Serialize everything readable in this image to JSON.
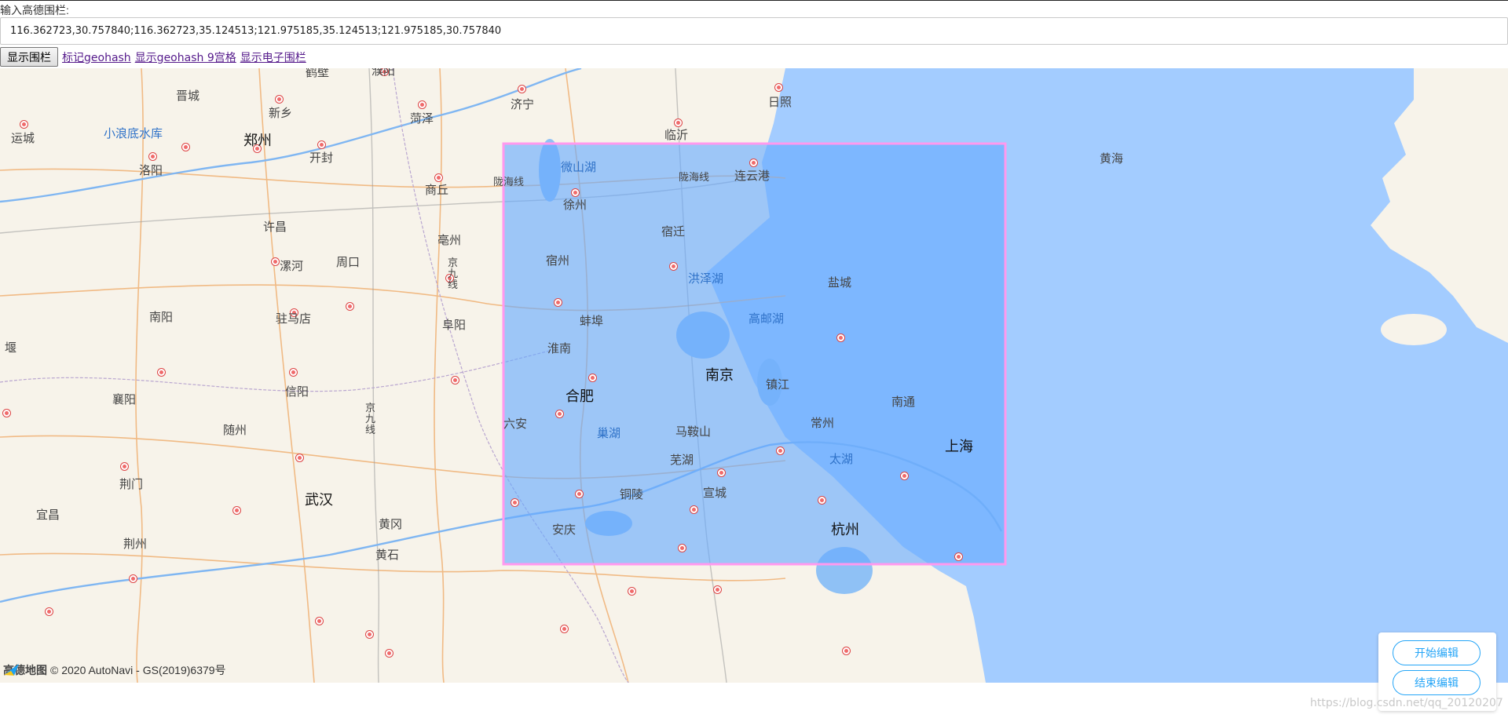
{
  "form": {
    "label": "输入高德围栏:",
    "fence_value": "116.362723,30.757840;116.362723,35.124513;121.975185,35.124513;121.975185,30.757840",
    "show_button": "显示围栏",
    "links": [
      "标记geohash",
      "显示geohash 9宫格",
      "显示电子围栏"
    ]
  },
  "map": {
    "labels": {
      "hebi": "鹤壁",
      "puyang": "濮阳",
      "jincheng": "晋城",
      "xinxiang": "新乡",
      "heze": "菏泽",
      "jining": "济宁",
      "rizhao": "日照",
      "yuncheng": "运城",
      "xiaolangdi": "小浪底水库",
      "zhengzhou": "郑州",
      "kaifeng": "开封",
      "luoyang": "洛阳",
      "shangqiu": "商丘",
      "linyi": "临沂",
      "weishanhu": "微山湖",
      "lianyungang": "连云港",
      "longhai_w": "陇海线",
      "longhai_e": "陇海线",
      "xuzhou": "徐州",
      "huanghai": "黄海",
      "xuchang": "许昌",
      "suqian": "宿迁",
      "bozhou": "亳州",
      "luohe": "漯河",
      "zhoukou": "周口",
      "jingjiu_n": "京九线",
      "suzhou_ah": "宿州",
      "hongzehu": "洪泽湖",
      "yancheng": "盐城",
      "nanyang": "南阳",
      "zhumadian": "驻马店",
      "bengbu": "蚌埠",
      "gaoyouhu": "高邮湖",
      "fuyang": "阜阳",
      "huainan": "淮南",
      "yan": "堰",
      "nanjing": "南京",
      "zhenjiang": "镇江",
      "xinyang": "信阳",
      "xiangyang": "襄阳",
      "hefei": "合肥",
      "nantong": "南通",
      "jingjiu_s": "京九线",
      "liuan": "六安",
      "changzhou": "常州",
      "suizhou": "随州",
      "chaohu": "巢湖",
      "maanshan": "马鞍山",
      "shanghai": "上海",
      "taihu": "太湖",
      "wuhu": "芜湖",
      "jingmen": "荆门",
      "tongling": "铜陵",
      "xuancheng": "宣城",
      "yichang": "宜昌",
      "wuhan": "武汉",
      "huanggang": "黄冈",
      "anqing": "安庆",
      "hangzhou": "杭州",
      "jingzhou": "荆州",
      "huangshi": "黄石"
    },
    "attribution": "© 2020 AutoNavi - GS(2019)6379号",
    "logo_text": "高德地图",
    "fence_color": "#66aaff",
    "sea_color": "#a3ccff"
  },
  "edit_panel": {
    "start_label": "开始编辑",
    "end_label": "结束编辑"
  },
  "watermark": "https://blog.csdn.net/qq_20120207"
}
